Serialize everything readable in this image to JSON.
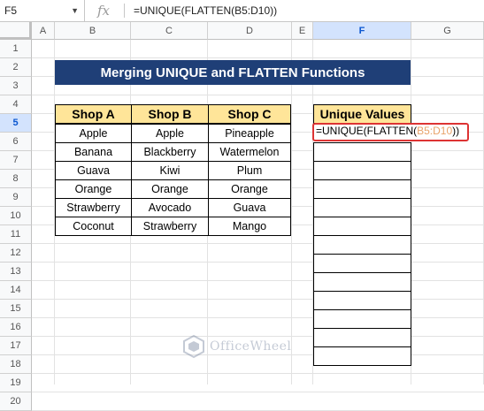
{
  "formula_bar": {
    "name_box": "F5",
    "fx_label": "fx",
    "formula": "=UNIQUE(FLATTEN(B5:D10))"
  },
  "columns": [
    "A",
    "B",
    "C",
    "D",
    "E",
    "F",
    "G"
  ],
  "rows": [
    "1",
    "2",
    "3",
    "4",
    "5",
    "6",
    "7",
    "8",
    "9",
    "10",
    "11",
    "12",
    "13",
    "14",
    "15",
    "16",
    "17",
    "18",
    "19",
    "20"
  ],
  "title": "Merging UNIQUE and FLATTEN Functions",
  "table": {
    "headers": [
      "Shop A",
      "Shop B",
      "Shop C"
    ],
    "rows": [
      [
        "Apple",
        "Apple",
        "Pineapple"
      ],
      [
        "Banana",
        "Blackberry",
        "Watermelon"
      ],
      [
        "Guava",
        "Kiwi",
        "Plum"
      ],
      [
        "Orange",
        "Orange",
        "Orange"
      ],
      [
        "Strawberry",
        "Avocado",
        "Guava"
      ],
      [
        "Coconut",
        "Strawberry",
        "Mango"
      ]
    ]
  },
  "unique_values": {
    "header": "Unique Values",
    "active_formula_prefix": "=UNIQUE(FLATTEN(",
    "active_formula_range": "B5:D10",
    "active_formula_suffix": "))"
  },
  "watermark": "OfficeWheel",
  "colors": {
    "title_bg": "#1f3f77",
    "header_bg": "#ffe599",
    "selection_border": "#d33333",
    "range_ref": "#e8a36a"
  }
}
